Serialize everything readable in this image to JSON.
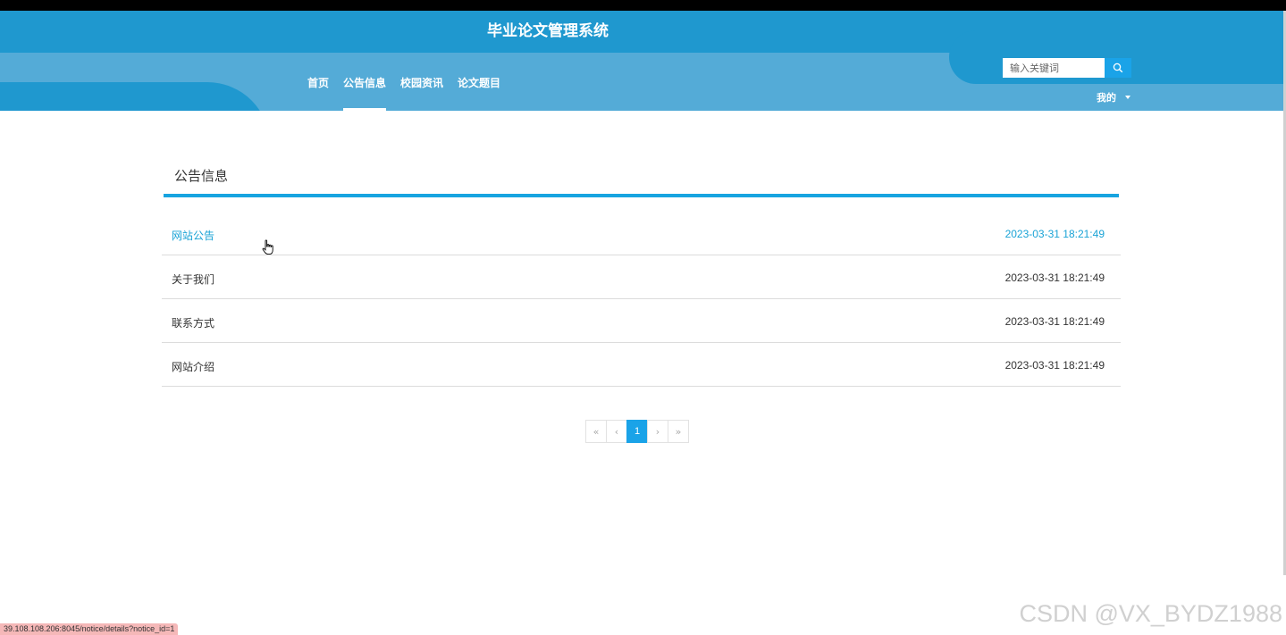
{
  "header": {
    "site_title": "毕业论文管理系统",
    "nav": [
      {
        "label": "首页",
        "active": false
      },
      {
        "label": "公告信息",
        "active": true
      },
      {
        "label": "校园资讯",
        "active": false
      },
      {
        "label": "论文题目",
        "active": false
      }
    ],
    "search": {
      "placeholder": "输入关键词",
      "value": "",
      "icon": "search-icon"
    },
    "user_menu": {
      "label": "我的",
      "icon": "caret-down-icon"
    }
  },
  "main": {
    "section_title": "公告信息",
    "notices": [
      {
        "title": "网站公告",
        "date": "2023-03-31 18:21:49",
        "highlighted": true
      },
      {
        "title": "关于我们",
        "date": "2023-03-31 18:21:49",
        "highlighted": false
      },
      {
        "title": "联系方式",
        "date": "2023-03-31 18:21:49",
        "highlighted": false
      },
      {
        "title": "网站介绍",
        "date": "2023-03-31 18:21:49",
        "highlighted": false
      }
    ],
    "pagination": {
      "first": "«",
      "prev": "‹",
      "current": "1",
      "next": "›",
      "last": "»"
    }
  },
  "status_bar": {
    "url": "39.108.108.206:8045/notice/details?notice_id=1"
  },
  "watermark": "CSDN @VX_BYDZ1988",
  "colors": {
    "header_dark": "#1f98cf",
    "header_light": "#54abd7",
    "accent": "#1aa3e8",
    "link_hover": "#1aa3d6"
  }
}
